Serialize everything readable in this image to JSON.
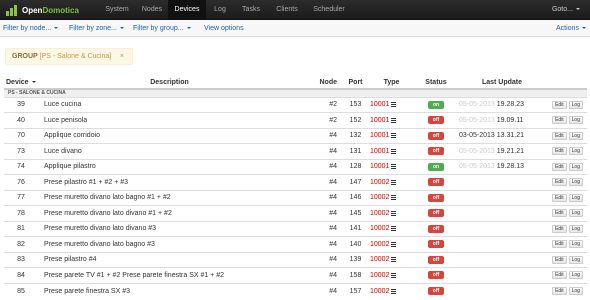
{
  "app": {
    "brand_part1": "Open",
    "brand_part2": "Domotica",
    "nav": [
      "System",
      "Nodes",
      "Devices",
      "Log",
      "Tasks",
      "Clients",
      "Scheduler"
    ],
    "active_nav": "Devices",
    "goto_label": "Goto"
  },
  "subnav": {
    "filter_node": "Filter by node...",
    "filter_zone": "Filter by zone...",
    "filter_group": "Filter by group...",
    "view_options": "View options",
    "actions": "Actions"
  },
  "group_filter": {
    "label": "GROUP",
    "value": "[PS - Salone & Cucina]",
    "close": "×"
  },
  "table": {
    "headers": {
      "device": "Device",
      "description": "Description",
      "node": "Node",
      "port": "Port",
      "type": "Type",
      "status": "Status",
      "last_update": "Last Update"
    },
    "group_label": "PS - SALONE & CUCINA",
    "edit_label": "Edit",
    "log_label": "Log",
    "rows": [
      {
        "device": "39",
        "description": "Luce cucina",
        "node": "#2",
        "port": "153",
        "type": "10001",
        "status": "on",
        "date": "05-05-2013",
        "time": "19.28.23",
        "date_dark": false
      },
      {
        "device": "40",
        "description": "Luce penisola",
        "node": "#2",
        "port": "152",
        "type": "10001",
        "status": "off",
        "date": "05-05-2013",
        "time": "19.09.11",
        "date_dark": false
      },
      {
        "device": "70",
        "description": "Applique corridoio",
        "node": "#4",
        "port": "132",
        "type": "10001",
        "status": "off",
        "date": "03-05-2013",
        "time": "13.31.21",
        "date_dark": true
      },
      {
        "device": "73",
        "description": "Luce divano",
        "node": "#4",
        "port": "131",
        "type": "10001",
        "status": "off",
        "date": "05-05-2013",
        "time": "19.21.21",
        "date_dark": false
      },
      {
        "device": "74",
        "description": "Applique pilastro",
        "node": "#4",
        "port": "128",
        "type": "10001",
        "status": "on",
        "date": "05-05-2013",
        "time": "19.28.13",
        "date_dark": false
      },
      {
        "device": "76",
        "description": "Prese pilastro #1 + #2 + #3",
        "node": "#4",
        "port": "147",
        "type": "10002",
        "status": "off",
        "date": "",
        "time": "",
        "date_dark": false
      },
      {
        "device": "77",
        "description": "Prese muretto divano lato bagno #1 + #2",
        "node": "#4",
        "port": "146",
        "type": "10002",
        "status": "off",
        "date": "",
        "time": "",
        "date_dark": false
      },
      {
        "device": "78",
        "description": "Prese muretto divano lato divano #1 + #2",
        "node": "#4",
        "port": "145",
        "type": "10002",
        "status": "off",
        "date": "",
        "time": "",
        "date_dark": false
      },
      {
        "device": "81",
        "description": "Prese muretto divano lato divano #3",
        "node": "#4",
        "port": "141",
        "type": "10002",
        "status": "off",
        "date": "",
        "time": "",
        "date_dark": false
      },
      {
        "device": "82",
        "description": "Prese muretto divano lato bagno #3",
        "node": "#4",
        "port": "140",
        "type": "10002",
        "status": "off",
        "date": "",
        "time": "",
        "date_dark": false
      },
      {
        "device": "83",
        "description": "Prese pilastro #4",
        "node": "#4",
        "port": "139",
        "type": "10002",
        "status": "off",
        "date": "",
        "time": "",
        "date_dark": false
      },
      {
        "device": "84",
        "description": "Prese parete TV #1 + #2 Prese parete finestra SX #1 + #2",
        "node": "#4",
        "port": "158",
        "type": "10002",
        "status": "off",
        "date": "",
        "time": "",
        "date_dark": false
      },
      {
        "device": "85",
        "description": "Prese parete finestra SX #3",
        "node": "#4",
        "port": "157",
        "type": "10002",
        "status": "off",
        "date": "",
        "time": "",
        "date_dark": false
      }
    ]
  },
  "colors": {
    "navbar": "#1b1b1b",
    "link": "#1e62b3",
    "status_on": "#4cae4c",
    "status_off": "#d9443f",
    "type_text": "#cc0000"
  }
}
